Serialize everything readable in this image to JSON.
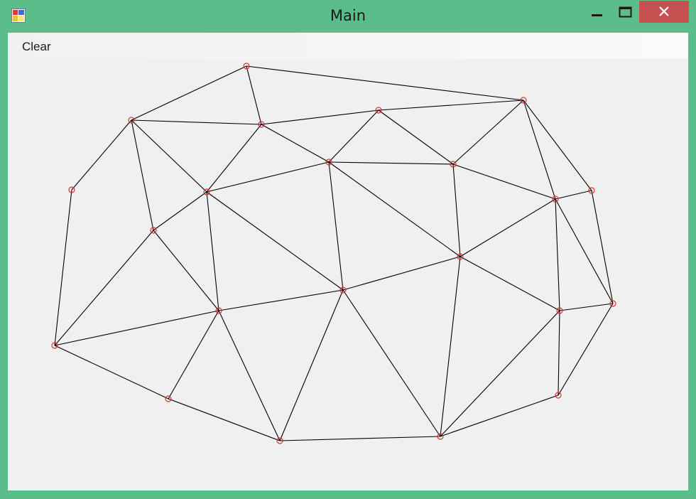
{
  "window": {
    "title": "Main",
    "colors": {
      "frame": "#5bbd89",
      "close": "#c75050",
      "client": "#f0f0f0",
      "edge": "#000000",
      "vertex": "#e03030"
    },
    "icons": [
      "app-icon",
      "minimize-icon",
      "maximize-icon",
      "close-icon"
    ]
  },
  "menu": {
    "clear_label": "Clear"
  }
}
